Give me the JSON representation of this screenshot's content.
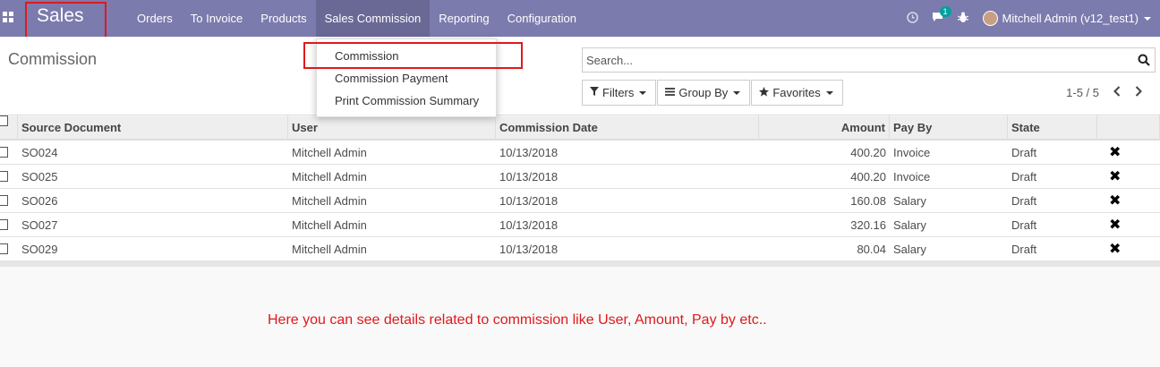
{
  "navbar": {
    "brand": "Sales",
    "menu": [
      "Orders",
      "To Invoice",
      "Products",
      "Sales Commission",
      "Reporting",
      "Configuration"
    ],
    "active_menu": "Sales Commission",
    "messages_badge": "1",
    "user": "Mitchell Admin (v12_test1)",
    "color": "#7c7bad"
  },
  "breadcrumb": "Commission",
  "search": {
    "placeholder": "Search..."
  },
  "search_buttons": {
    "filters": "Filters",
    "group_by": "Group By",
    "favorites": "Favorites"
  },
  "pager": "1-5 / 5",
  "dropdown": [
    "Commission",
    "Commission Payment",
    "Print Commission Summary"
  ],
  "table": {
    "headers": [
      "Source Document",
      "User",
      "Commission Date",
      "Amount",
      "Pay By",
      "State"
    ],
    "rows": [
      {
        "doc": "SO024",
        "user": "Mitchell Admin",
        "date": "10/13/2018",
        "amount": "400.20",
        "pay_by": "Invoice",
        "state": "Draft"
      },
      {
        "doc": "SO025",
        "user": "Mitchell Admin",
        "date": "10/13/2018",
        "amount": "400.20",
        "pay_by": "Invoice",
        "state": "Draft"
      },
      {
        "doc": "SO026",
        "user": "Mitchell Admin",
        "date": "10/13/2018",
        "amount": "160.08",
        "pay_by": "Salary",
        "state": "Draft"
      },
      {
        "doc": "SO027",
        "user": "Mitchell Admin",
        "date": "10/13/2018",
        "amount": "320.16",
        "pay_by": "Salary",
        "state": "Draft"
      },
      {
        "doc": "SO029",
        "user": "Mitchell Admin",
        "date": "10/13/2018",
        "amount": "80.04",
        "pay_by": "Salary",
        "state": "Draft"
      }
    ]
  },
  "annotation": "Here you can see details related to commission like User, Amount, Pay by etc.."
}
